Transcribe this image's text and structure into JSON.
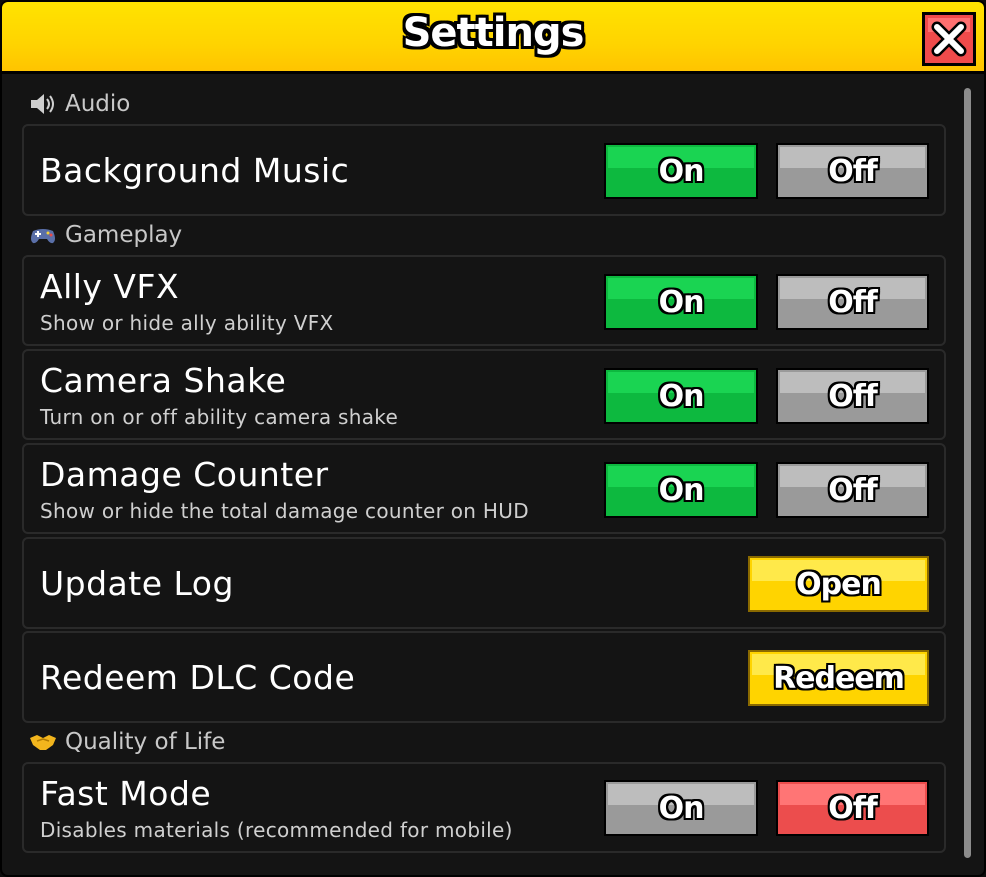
{
  "window": {
    "title": "Settings",
    "close_icon": "close-x-icon"
  },
  "colors": {
    "title_bar": "#ffd400",
    "on_active": "#0db93f",
    "inactive": "#9a9a9a",
    "off_active": "#ec4d4d",
    "action": "#ffd400"
  },
  "sections": {
    "audio": {
      "label": "Audio",
      "icon": "speaker-icon"
    },
    "gameplay": {
      "label": "Gameplay",
      "icon": "gamepad-icon"
    },
    "qol": {
      "label": "Quality of Life",
      "icon": "handshake-icon"
    }
  },
  "settings": {
    "background_music": {
      "title": "Background Music",
      "on": "On",
      "off": "Off",
      "state": "On"
    },
    "ally_vfx": {
      "title": "Ally VFX",
      "desc": "Show or hide ally ability VFX",
      "on": "On",
      "off": "Off",
      "state": "On"
    },
    "camera_shake": {
      "title": "Camera Shake",
      "desc": "Turn on or off ability camera shake",
      "on": "On",
      "off": "Off",
      "state": "On"
    },
    "damage_counter": {
      "title": "Damage Counter",
      "desc": "Show or hide the total damage counter on HUD",
      "on": "On",
      "off": "Off",
      "state": "On"
    },
    "update_log": {
      "title": "Update Log",
      "button": "Open"
    },
    "redeem_dlc": {
      "title": "Redeem DLC Code",
      "button": "Redeem"
    },
    "fast_mode": {
      "title": "Fast Mode",
      "desc": "Disables materials (recommended for mobile)",
      "on": "On",
      "off": "Off",
      "state": "Off"
    }
  }
}
